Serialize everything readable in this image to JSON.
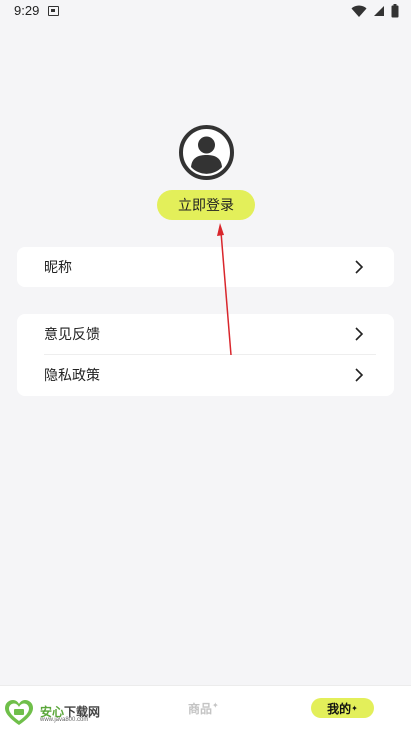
{
  "status_bar": {
    "time": "9:29",
    "icons": [
      "sim-card-icon",
      "wifi-icon",
      "signal-icon",
      "battery-icon"
    ]
  },
  "profile": {
    "avatar_icon": "user-avatar-icon",
    "login_label": "立即登录"
  },
  "settings_card_1": {
    "items": [
      {
        "label": "昵称",
        "icon": "chevron-right-icon"
      }
    ]
  },
  "settings_card_2": {
    "items": [
      {
        "label": "意见反馈",
        "icon": "chevron-right-icon"
      },
      {
        "label": "隐私政策",
        "icon": "chevron-right-icon"
      }
    ]
  },
  "bottom_nav": {
    "watermark": {
      "prefix": "安心",
      "suffix": "下载网",
      "site": "www.java800.com"
    },
    "tabs": [
      {
        "label": "商品",
        "badge": "✦",
        "active": false
      },
      {
        "label": "我的",
        "badge": "✦",
        "active": true
      }
    ]
  },
  "colors": {
    "accent": "#e3ef5a",
    "background": "#f5f5f7",
    "annotation_arrow": "#d9262c"
  }
}
